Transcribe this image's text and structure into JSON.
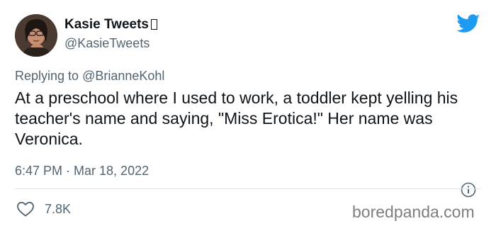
{
  "author": {
    "display_name": "Kasie Tweets",
    "handle": "@KasieTweets"
  },
  "reply": {
    "prefix": "Replying to ",
    "mention": "@BrianneKohl"
  },
  "tweet": {
    "text": "At a preschool where I used to work, a toddler kept yelling his teacher's name and saying, \"Miss Erotica!\" Her name was Veronica.",
    "timestamp": "6:47 PM · Mar 18, 2022"
  },
  "engagement": {
    "likes": "7.8K"
  },
  "watermark": "boredpanda.com",
  "icons": {
    "brand": "twitter-bird-icon",
    "info": "info-icon",
    "like": "heart-icon"
  },
  "colors": {
    "twitter_blue": "#1d9bf0",
    "text_primary": "#0f1419",
    "text_secondary": "#536471",
    "divider": "#e1e4e6"
  }
}
